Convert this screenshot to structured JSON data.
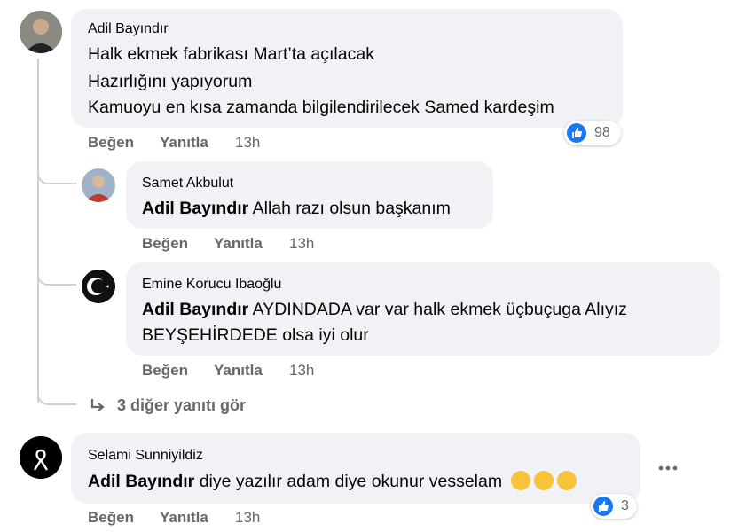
{
  "comments": [
    {
      "author": "Adil Bayındır",
      "lines": [
        "Halk ekmek fabrikası Mart’ta açılacak",
        "Hazırlığını yapıyorum",
        "Kamuoyu en kısa zamanda bilgilendirilecek Samed kardeşim"
      ],
      "like_label": "Beğen",
      "reply_label": "Yanıtla",
      "time": "13h",
      "reaction_count": "98"
    },
    {
      "author": "Samet Akbulut",
      "mention": "Adil Bayındır",
      "text": " Allah razı olsun başkanım",
      "like_label": "Beğen",
      "reply_label": "Yanıtla",
      "time": "13h"
    },
    {
      "author": "Emine Korucu Ibaoğlu",
      "mention": "Adil Bayındır",
      "text": " AYDINDADA var var halk ekmek üçbuçuga Alıyız",
      "text2": "BEYŞEHİRDEDE olsa iyi olur",
      "like_label": "Beğen",
      "reply_label": "Yanıtla",
      "time": "13h"
    },
    {
      "author": "Selami Sunniyildiz",
      "mention": "Adil Bayındır",
      "text": " diye yazılır adam diye okunur vesselam",
      "like_label": "Beğen",
      "reply_label": "Yanıtla",
      "time": "13h",
      "reaction_count": "3"
    }
  ],
  "more_replies": "3 diğer yanıtı gör",
  "icons": {
    "like": "thumbs-up-icon",
    "reply_arrow": "reply-arrow-icon",
    "more": "more-options-icon",
    "clap": "clapping-hands-emoji"
  },
  "colors": {
    "bubble": "#f0f2f5",
    "like_blue": "#1877f2",
    "muted_text": "#65676b"
  }
}
